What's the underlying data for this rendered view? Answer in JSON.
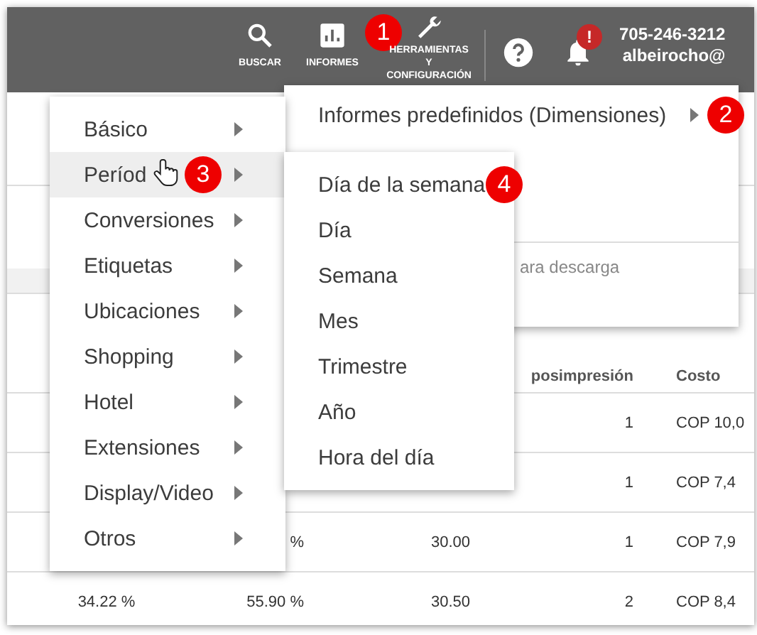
{
  "header": {
    "actions": [
      {
        "kind": "search",
        "label": "BUSCAR"
      },
      {
        "kind": "reports",
        "label": "INFORMES",
        "callout": "1"
      },
      {
        "kind": "tools",
        "label": "HERRAMIENTAS Y CONFIGURACIÓN"
      }
    ],
    "help": {
      "kind": "help"
    },
    "notifications": {
      "badge": "!"
    },
    "account": {
      "phone": "705-246-3212",
      "email": "albeirocho@"
    }
  },
  "table": {
    "headers": {
      "column_4": "posimpresión",
      "column_5": "Costo"
    },
    "rows": [
      {
        "column_4": "1",
        "column_5": "COP 10,0"
      },
      {
        "column_4": "1",
        "column_5": "COP 7,4"
      },
      {
        "column_2": "%",
        "column_3": "30.00",
        "column_4": "1",
        "column_5": "COP 7,9"
      },
      {
        "column_1": "34.22 %",
        "column_2": "55.90 %",
        "column_3": "30.50",
        "column_4": "2",
        "column_5": "COP 8,4"
      }
    ]
  },
  "reports_menu": {
    "items": [
      {
        "label": "Informes predefinidos (Dimensiones)",
        "submenu": true,
        "callout": "2"
      }
    ],
    "footer": "ara descarga"
  },
  "categories_menu": {
    "items": [
      {
        "label": "Básico",
        "submenu": true,
        "selected": false
      },
      {
        "label": "Períod",
        "submenu": true,
        "selected": true,
        "callout": "3",
        "pointer": true
      },
      {
        "label": "Conversiones",
        "submenu": true,
        "selected": false
      },
      {
        "label": "Etiquetas",
        "submenu": true,
        "selected": false
      },
      {
        "label": "Ubicaciones",
        "submenu": true,
        "selected": false
      },
      {
        "label": "Shopping",
        "submenu": true,
        "selected": false
      },
      {
        "label": "Hotel",
        "submenu": true,
        "selected": false
      },
      {
        "label": "Extensiones",
        "submenu": true,
        "selected": false
      },
      {
        "label": "Display/Video",
        "submenu": true,
        "selected": false
      },
      {
        "label": "Otros",
        "submenu": true,
        "selected": false
      }
    ]
  },
  "period_menu": {
    "items": [
      {
        "label": "Día de la semana",
        "selected": false,
        "callout": "4"
      },
      {
        "label": "Día",
        "selected": false
      },
      {
        "label": "Semana",
        "selected": false
      },
      {
        "label": "Mes",
        "selected": false
      },
      {
        "label": "Trimestre",
        "selected": false
      },
      {
        "label": "Año",
        "selected": false
      },
      {
        "label": "Hora del día",
        "selected": false
      }
    ]
  }
}
